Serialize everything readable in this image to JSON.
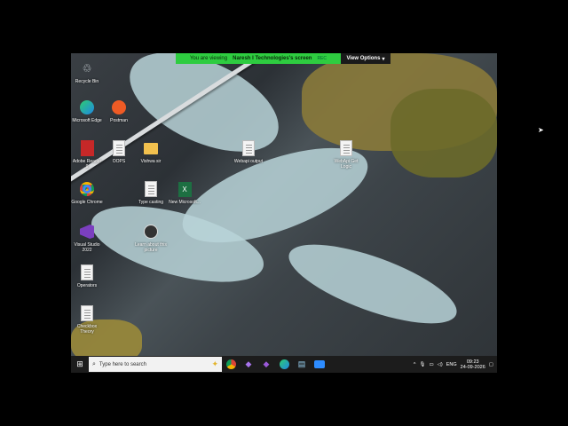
{
  "banner": {
    "prefix": "You are viewing",
    "owner": "Naresh I Technologies's screen",
    "rec": "REC",
    "view_options": "View Options"
  },
  "desktop_icons": [
    {
      "label": "Recycle Bin",
      "icon": "recycle-bin-icon"
    },
    {
      "label": "Microsoft Edge",
      "icon": "edge-icon"
    },
    {
      "label": "Postman",
      "icon": "postman-icon"
    },
    {
      "label": "Adobe Reader 9",
      "icon": "pdf-icon"
    },
    {
      "label": "OOPS",
      "icon": "document-icon"
    },
    {
      "label": "Vishwa sir",
      "icon": "folder-icon"
    },
    {
      "label": "Webapi output",
      "icon": "document-icon"
    },
    {
      "label": "WebApi Get Logic",
      "icon": "document-icon"
    },
    {
      "label": "Google Chrome",
      "icon": "chrome-icon"
    },
    {
      "label": "Type casting",
      "icon": "document-icon"
    },
    {
      "label": "New Microsoft...",
      "icon": "excel-icon"
    },
    {
      "label": "Visual Studio 2022",
      "icon": "visual-studio-icon"
    },
    {
      "label": "Learn about this picture",
      "icon": "camera-icon"
    },
    {
      "label": "Operators",
      "icon": "document-icon"
    },
    {
      "label": "Checkbox Theory",
      "icon": "document-icon"
    }
  ],
  "taskbar": {
    "search_placeholder": "Type here to search",
    "lang": "ENG",
    "time": "09:23",
    "date": "24-09-2026"
  },
  "colors": {
    "banner": "#2ecc40",
    "taskbar": "#1c1c1c"
  }
}
